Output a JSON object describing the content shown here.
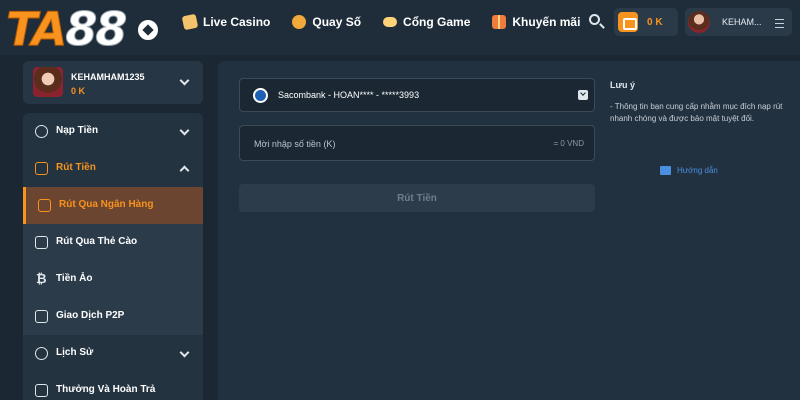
{
  "header": {
    "logo_text_ta": "TA",
    "logo_text_88": "88",
    "nav": [
      {
        "label": "Live Casino",
        "icon": "playing-card-icon"
      },
      {
        "label": "Quay Số",
        "icon": "lottery-ball-icon"
      },
      {
        "label": "Cổng Game",
        "icon": "gamepad-icon"
      },
      {
        "label": "Khuyến mãi",
        "icon": "gift-icon"
      }
    ],
    "wallet_balance": "0 K",
    "profile_name": "KEHAM..."
  },
  "user_card": {
    "username": "KEHAMHAM1235",
    "balance": "0 K"
  },
  "sidebar": {
    "items": [
      {
        "label": "Nạp Tiền",
        "icon": "deposit-icon"
      },
      {
        "label": "Rút Tiền",
        "icon": "withdraw-icon"
      },
      {
        "label": "Rút Qua Ngân Hàng",
        "icon": "bank-icon"
      },
      {
        "label": "Rút Qua Thẻ Cào",
        "icon": "scratch-card-icon"
      },
      {
        "label": "Tiền Ảo",
        "icon": "bitcoin-icon"
      },
      {
        "label": "Giao Dịch P2P",
        "icon": "p2p-icon"
      },
      {
        "label": "Lịch Sử",
        "icon": "history-icon"
      },
      {
        "label": "Thưởng Và Hoàn Trả",
        "icon": "reward-icon"
      }
    ]
  },
  "withdraw_form": {
    "selected_bank": "Sacombank - HOAN**** - *****3993",
    "amount_placeholder": "Mời nhập số tiền (K)",
    "amount_suffix": "= 0 VND",
    "submit_label": "Rút Tiền"
  },
  "note": {
    "title": "Lưu ý",
    "body": "- Thông tin bạn cung cấp nhằm mục đích nạp rút nhanh chóng và được bảo mật tuyệt đối.",
    "guide_label": "Hướng dẫn"
  },
  "colors": {
    "accent": "#f7931e",
    "background": "#1b2834",
    "panel": "#223140",
    "link": "#4a8fe0"
  }
}
